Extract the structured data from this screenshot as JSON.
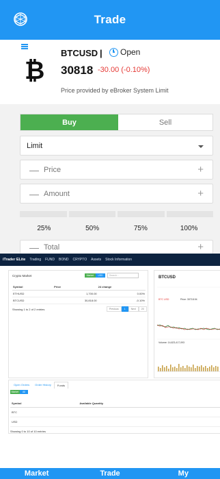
{
  "header": {
    "title": "Trade",
    "logo_icon": "globe-logo-icon"
  },
  "quote": {
    "coin_icon": "bitcoin-icon",
    "coin_glyph": "₿",
    "symbol": "BTCUSD",
    "separator": "|",
    "status": "Open",
    "price": "30818",
    "change": "-30.00 (-0.10%)",
    "provider": "Price provided by eBroker System Limit",
    "change_color": "#e53935"
  },
  "order": {
    "buy_label": "Buy",
    "sell_label": "Sell",
    "order_type": "Limit",
    "price_label": "Price",
    "amount_label": "Amount",
    "total_label": "Total",
    "minus": "—",
    "plus": "+",
    "percentages": [
      "25%",
      "50%",
      "75%",
      "100%"
    ]
  },
  "web": {
    "nav": [
      "iTrader ELite",
      "Trading",
      "FUND",
      "BOND",
      "CRYPTO",
      "Assets",
      "Stock Information"
    ],
    "market_panel": {
      "title": "Crypto Market",
      "market_btn": "Market",
      "usd_btn": "USD",
      "search_placeholder": "Search...",
      "columns": [
        "Symbol",
        "Price",
        "24 change"
      ],
      "rows": [
        {
          "symbol": "ETHUSD",
          "price": "1,700.00",
          "change": "0.00%"
        },
        {
          "symbol": "BTCUSD",
          "price": "30,818.00",
          "change": "-0.10%"
        }
      ],
      "showing": "Showing 1 to 2 of 2 entries",
      "pager": [
        "Previous",
        "1",
        "Next",
        "20"
      ]
    },
    "chart_panel": {
      "title": "BTCUSD",
      "label": "BTC USD",
      "price_text": "Price: 30718.94",
      "volume_text": "Volume: 14,623,417,093"
    },
    "funds_panel": {
      "tabs": [
        "Open Orders",
        "Order History",
        "Funds"
      ],
      "market_btn": "Market",
      "usd_btn": "All",
      "columns": [
        "Symbol",
        "Available Quantity"
      ],
      "rows": [
        "BTC",
        "USD"
      ],
      "showing": "Showing 0 to 10 of 10 entries"
    }
  },
  "bottom_nav": {
    "market": "Market",
    "trade": "Trade",
    "my": "My"
  },
  "colors": {
    "primary": "#2196f3",
    "buy": "#4caf50",
    "negative": "#e53935"
  }
}
